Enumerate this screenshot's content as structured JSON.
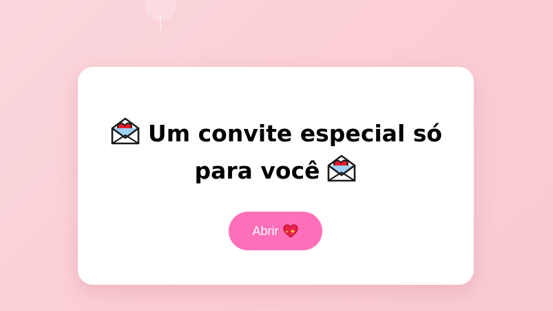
{
  "invitation": {
    "title_line_1": "Um convite especial só",
    "title_line_2": "para você",
    "title_icon": "envelope-with-heart-icon",
    "button_label": "Abrir",
    "button_icon": "sparkling-heart-icon"
  },
  "colors": {
    "background": "#fccdd5",
    "card": "#ffffff",
    "button": "#ff6fba",
    "button_text": "#ffffff",
    "title_text": "#000000"
  }
}
